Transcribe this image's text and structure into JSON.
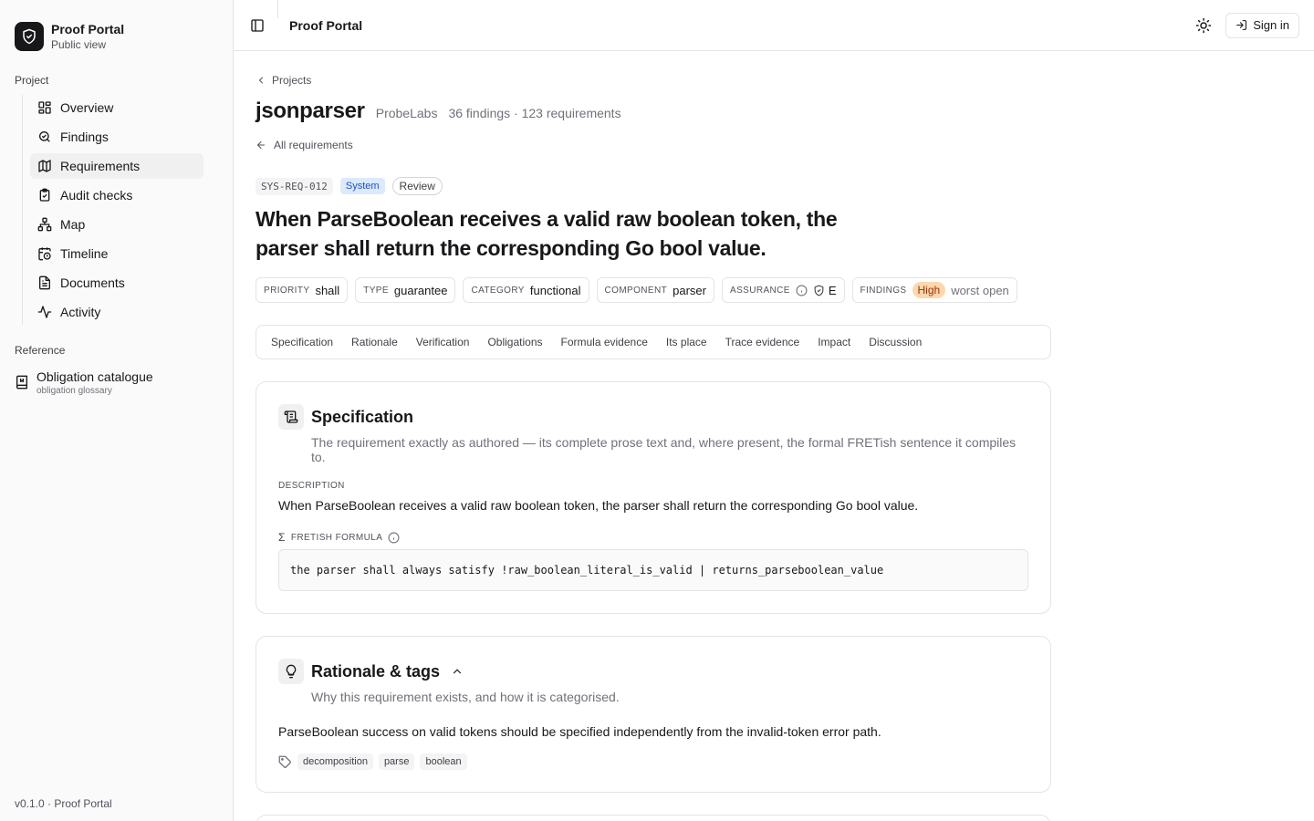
{
  "brand": {
    "name": "Proof Portal",
    "subtitle": "Public view"
  },
  "sidebar": {
    "project_label": "Project",
    "items": [
      {
        "label": "Overview",
        "icon": "grid-icon"
      },
      {
        "label": "Findings",
        "icon": "search-icon"
      },
      {
        "label": "Requirements",
        "icon": "map-icon",
        "active": true
      },
      {
        "label": "Audit checks",
        "icon": "clipboard-check-icon"
      },
      {
        "label": "Map",
        "icon": "network-icon"
      },
      {
        "label": "Timeline",
        "icon": "calendar-clock-icon"
      },
      {
        "label": "Documents",
        "icon": "file-text-icon"
      },
      {
        "label": "Activity",
        "icon": "activity-icon"
      }
    ],
    "reference_label": "Reference",
    "reference": {
      "title": "Obligation catalogue",
      "subtitle": "obligation glossary"
    },
    "footer": "v0.1.0 · Proof Portal"
  },
  "topbar": {
    "title": "Proof Portal",
    "signin_label": "Sign in"
  },
  "page": {
    "crumb": "Projects",
    "project_name": "jsonparser",
    "org": "ProbeLabs",
    "stats": "36 findings · 123 requirements",
    "back_label": "All requirements"
  },
  "requirement": {
    "id": "SYS-REQ-012",
    "level": "System",
    "status": "Review",
    "title": "When ParseBoolean receives a valid raw boolean token, the parser shall return the corresponding Go bool value.",
    "meta": {
      "priority_key": "PRIORITY",
      "priority": "shall",
      "type_key": "TYPE",
      "type": "guarantee",
      "category_key": "CATEGORY",
      "category": "functional",
      "component_key": "COMPONENT",
      "component": "parser",
      "assurance_key": "ASSURANCE",
      "assurance": "E",
      "findings_key": "FINDINGS",
      "findings_severity": "High",
      "findings_note": "worst open"
    }
  },
  "tabs": [
    "Specification",
    "Rationale",
    "Verification",
    "Obligations",
    "Formula evidence",
    "Its place",
    "Trace evidence",
    "Impact",
    "Discussion"
  ],
  "spec": {
    "title": "Specification",
    "desc": "The requirement exactly as authored — its complete prose text and, where present, the formal FRETish sentence it compiles to.",
    "description_label": "DESCRIPTION",
    "description": "When ParseBoolean receives a valid raw boolean token, the parser shall return the corresponding Go bool value.",
    "formula_label": "FRETISH FORMULA",
    "formula": "the parser shall always satisfy !raw_boolean_literal_is_valid | returns_parseboolean_value"
  },
  "rationale": {
    "title": "Rationale & tags",
    "desc": "Why this requirement exists, and how it is categorised.",
    "text": "ParseBoolean success on valid tokens should be specified independently from the invalid-token error path.",
    "tags": [
      "decomposition",
      "parse",
      "boolean"
    ]
  }
}
